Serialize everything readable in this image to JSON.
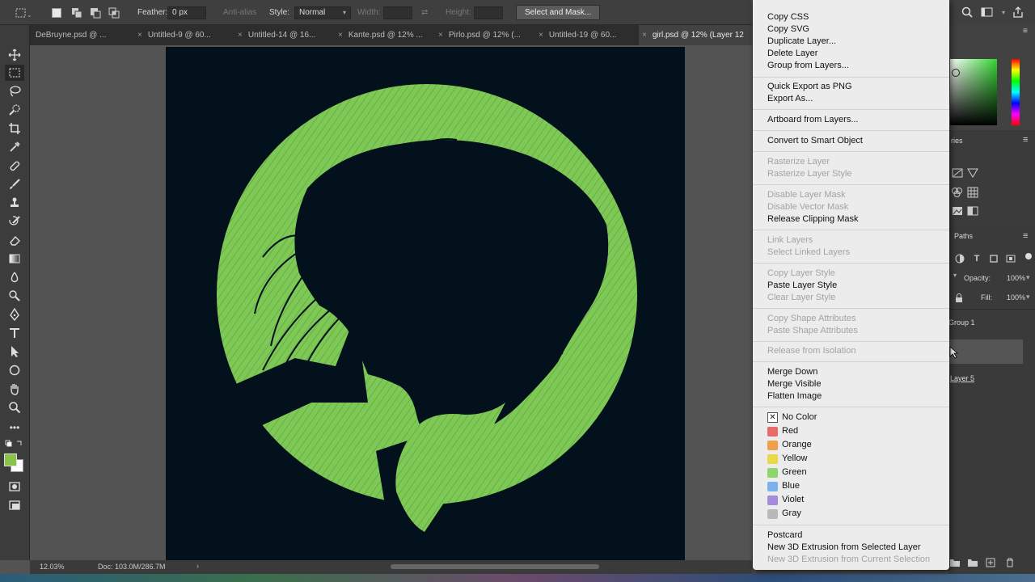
{
  "options_bar": {
    "feather_label": "Feather:",
    "feather_value": "0 px",
    "anti_alias_label": "Anti-alias",
    "style_label": "Style:",
    "style_value": "Normal",
    "width_label": "Width:",
    "height_label": "Height:",
    "select_mask_label": "Select and Mask..."
  },
  "tabs": [
    {
      "label": "DeBruyne.psd @ ..."
    },
    {
      "label": "Untitled-9 @ 60..."
    },
    {
      "label": "Untitled-14 @ 16..."
    },
    {
      "label": "Kante.psd @ 12% ..."
    },
    {
      "label": "Pirlo.psd @ 12% (..."
    },
    {
      "label": "Untitled-19 @ 60..."
    },
    {
      "label": "girl.psd @ 12% (Layer 12"
    }
  ],
  "tab_close_glyph": "×",
  "status": {
    "zoom": "12.03%",
    "doc": "Doc: 103.0M/286.7M"
  },
  "colors": {
    "canvas_bg": "#03111d",
    "artwork_green": "#7ec956",
    "foreground": "#8bc34a",
    "background": "#ffffff"
  },
  "context_menu": {
    "items": [
      {
        "label": "Copy CSS",
        "disabled": false
      },
      {
        "label": "Copy SVG",
        "disabled": false
      },
      {
        "label": "Duplicate Layer...",
        "disabled": false
      },
      {
        "label": "Delete Layer",
        "disabled": false
      },
      {
        "label": "Group from Layers...",
        "disabled": false
      },
      {
        "label": "Quick Export as PNG",
        "disabled": false
      },
      {
        "label": "Export As...",
        "disabled": false
      },
      {
        "label": "Artboard from Layers...",
        "disabled": false
      },
      {
        "label": "Convert to Smart Object",
        "disabled": false
      },
      {
        "label": "Rasterize Layer",
        "disabled": true
      },
      {
        "label": "Rasterize Layer Style",
        "disabled": true
      },
      {
        "label": "Disable Layer Mask",
        "disabled": true
      },
      {
        "label": "Disable Vector Mask",
        "disabled": true
      },
      {
        "label": "Release Clipping Mask",
        "disabled": false
      },
      {
        "label": "Link Layers",
        "disabled": true
      },
      {
        "label": "Select Linked Layers",
        "disabled": true
      },
      {
        "label": "Copy Layer Style",
        "disabled": true
      },
      {
        "label": "Paste Layer Style",
        "disabled": false
      },
      {
        "label": "Clear Layer Style",
        "disabled": true
      },
      {
        "label": "Copy Shape Attributes",
        "disabled": true
      },
      {
        "label": "Paste Shape Attributes",
        "disabled": true
      },
      {
        "label": "Release from Isolation",
        "disabled": true
      },
      {
        "label": "Merge Down",
        "disabled": false
      },
      {
        "label": "Merge Visible",
        "disabled": false
      },
      {
        "label": "Flatten Image",
        "disabled": false
      }
    ],
    "colors": [
      {
        "label": "No Color",
        "color": "#ffffff"
      },
      {
        "label": "Red",
        "color": "#e86a6a"
      },
      {
        "label": "Orange",
        "color": "#f0a04b"
      },
      {
        "label": "Yellow",
        "color": "#e8d84a"
      },
      {
        "label": "Green",
        "color": "#8ed66b"
      },
      {
        "label": "Blue",
        "color": "#7db1ec"
      },
      {
        "label": "Violet",
        "color": "#a78bdb"
      },
      {
        "label": "Gray",
        "color": "#b9b9b9"
      }
    ],
    "no_color_glyph": "✕",
    "postcard": {
      "label": "Postcard",
      "disabled": false
    },
    "extrusion_selected": {
      "label": "New 3D Extrusion from Selected Layer",
      "disabled": false
    },
    "extrusion_current": {
      "label": "New 3D Extrusion from Current Selection",
      "disabled": true
    }
  },
  "panels": {
    "libraries_partial": "ries",
    "paths_tab": "Paths",
    "opacity_label": "Opacity:",
    "opacity_value": "100%",
    "fill_label": "Fill:",
    "fill_value": "100%",
    "layer_group": "Group 1",
    "layer_5": "Layer 5"
  }
}
